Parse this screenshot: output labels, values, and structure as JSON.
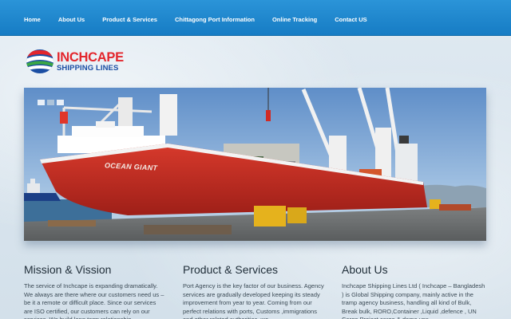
{
  "nav": {
    "items": [
      "Home",
      "About Us",
      "Product & Services",
      "Chittagong Port Information",
      "Online Tracking",
      "Contact US"
    ]
  },
  "logo": {
    "line1": "INCHCAPE",
    "line2": "SHIPPING LINES",
    "icon": "globe-logo-icon"
  },
  "hero": {
    "ship_name": "OCEAN GIANT",
    "slider_active_index": 1
  },
  "sections": {
    "mission": {
      "title": "Mission & Vission",
      "text": "The service of Inchcape is expanding dramatically. We always are there where our customers need us – be it a remote or difficult place. Since our services are ISO certified, our customers can rely on our services. We build long term relationship"
    },
    "products": {
      "title": "Product & Services",
      "text": "Port Agency is the key factor of our business. Agency services are gradually developed keeping its steady improvement from year to year. Coming from our perfect relations with ports, Customs ,immigrations and other related authorities, we"
    },
    "about": {
      "title": "About Us",
      "text": "Inchcape Shipping Lines Ltd ( Inchcape – Bangladesh ) is Global Shipping company, mainly active in the tramp agency business, handling all kind of Bulk, Break bulk, RORO,Container ,Liquid ,defence , UN Cargo,Project cargo & dome ups"
    }
  },
  "colors": {
    "nav_bg": "#1a84cc",
    "logo_red": "#e3262d",
    "logo_blue": "#1b4ea3",
    "hull_red": "#c82a22"
  }
}
